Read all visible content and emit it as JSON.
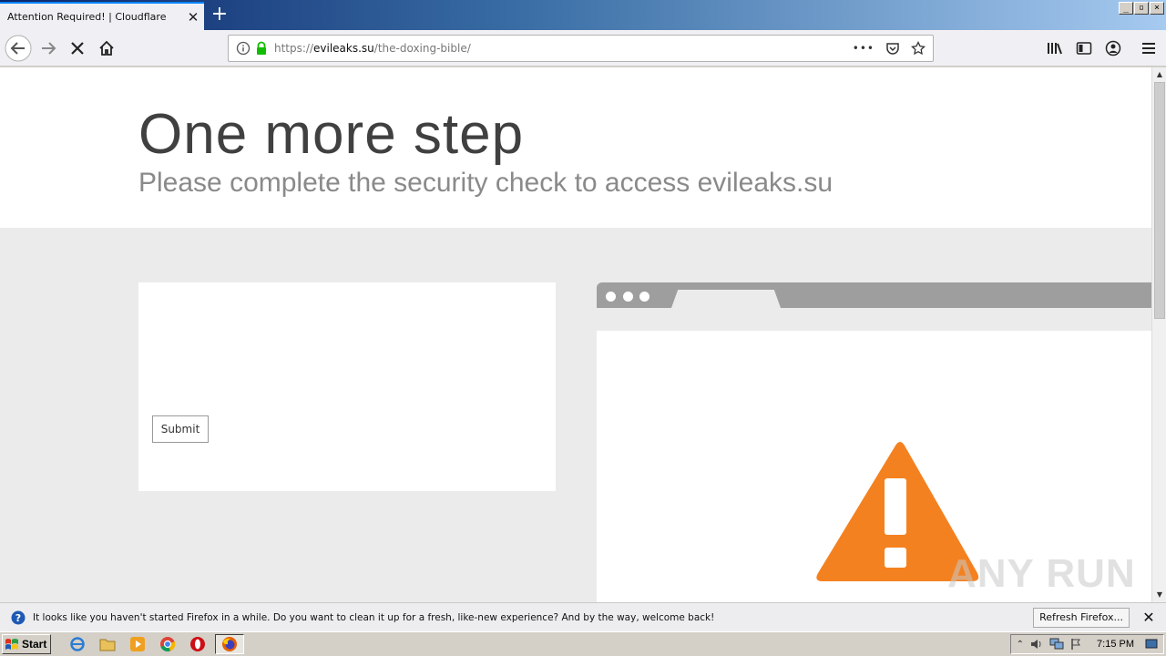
{
  "browser": {
    "tab_title": "Attention Required! | Cloudflare",
    "tab_close": "✕",
    "new_tab": "+",
    "window_controls": [
      "_",
      "▫",
      "×"
    ],
    "url_scheme": "https://",
    "url_host": "evileaks.su",
    "url_path": "/the-doxing-bible/",
    "page_actions": "•••"
  },
  "page": {
    "headline": "One more step",
    "subheadline": "Please complete the security check to access evileaks.su",
    "submit_label": "Submit",
    "watermark": "ANY RUN"
  },
  "notification": {
    "message": "It looks like you haven't started Firefox in a while. Do you want to clean it up for a fresh, like-new experience? And by the way, welcome back!",
    "button_label": "Refresh Firefox...",
    "close": "✕"
  },
  "taskbar": {
    "start_label": "Start",
    "clock": "7:15 PM"
  },
  "colors": {
    "warning_orange": "#f48120",
    "firefox_blue": "#0a84ff",
    "secure_green": "#12bc00"
  }
}
